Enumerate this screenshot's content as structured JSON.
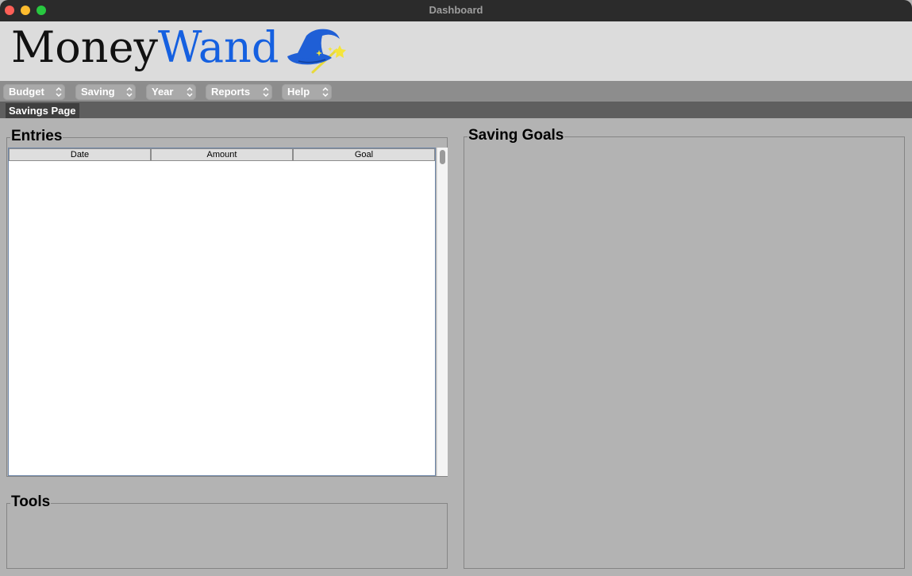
{
  "window": {
    "title": "Dashboard"
  },
  "logo": {
    "part1": "Money",
    "part2": "Wand",
    "icon": "wizard-hat-wand-icon"
  },
  "menubar": {
    "items": [
      {
        "label": "Budget"
      },
      {
        "label": "Saving"
      },
      {
        "label": "Year"
      },
      {
        "label": "Reports"
      },
      {
        "label": "Help"
      }
    ]
  },
  "tabs": {
    "active": "Savings Page"
  },
  "entries": {
    "title": "Entries",
    "columns": [
      "Date",
      "Amount",
      "Goal"
    ],
    "rows": []
  },
  "tools": {
    "title": "Tools"
  },
  "goals": {
    "title": "Saving Goals"
  },
  "colors": {
    "titlebar": "#2b2b2b",
    "header": "#dcdcdc",
    "menubar": "#8d8d8d",
    "tabstrip": "#5f5f5f",
    "body": "#b3b3b3",
    "logo_accent": "#1560e0",
    "hat": "#1f5fd6",
    "star": "#f5e53a"
  }
}
